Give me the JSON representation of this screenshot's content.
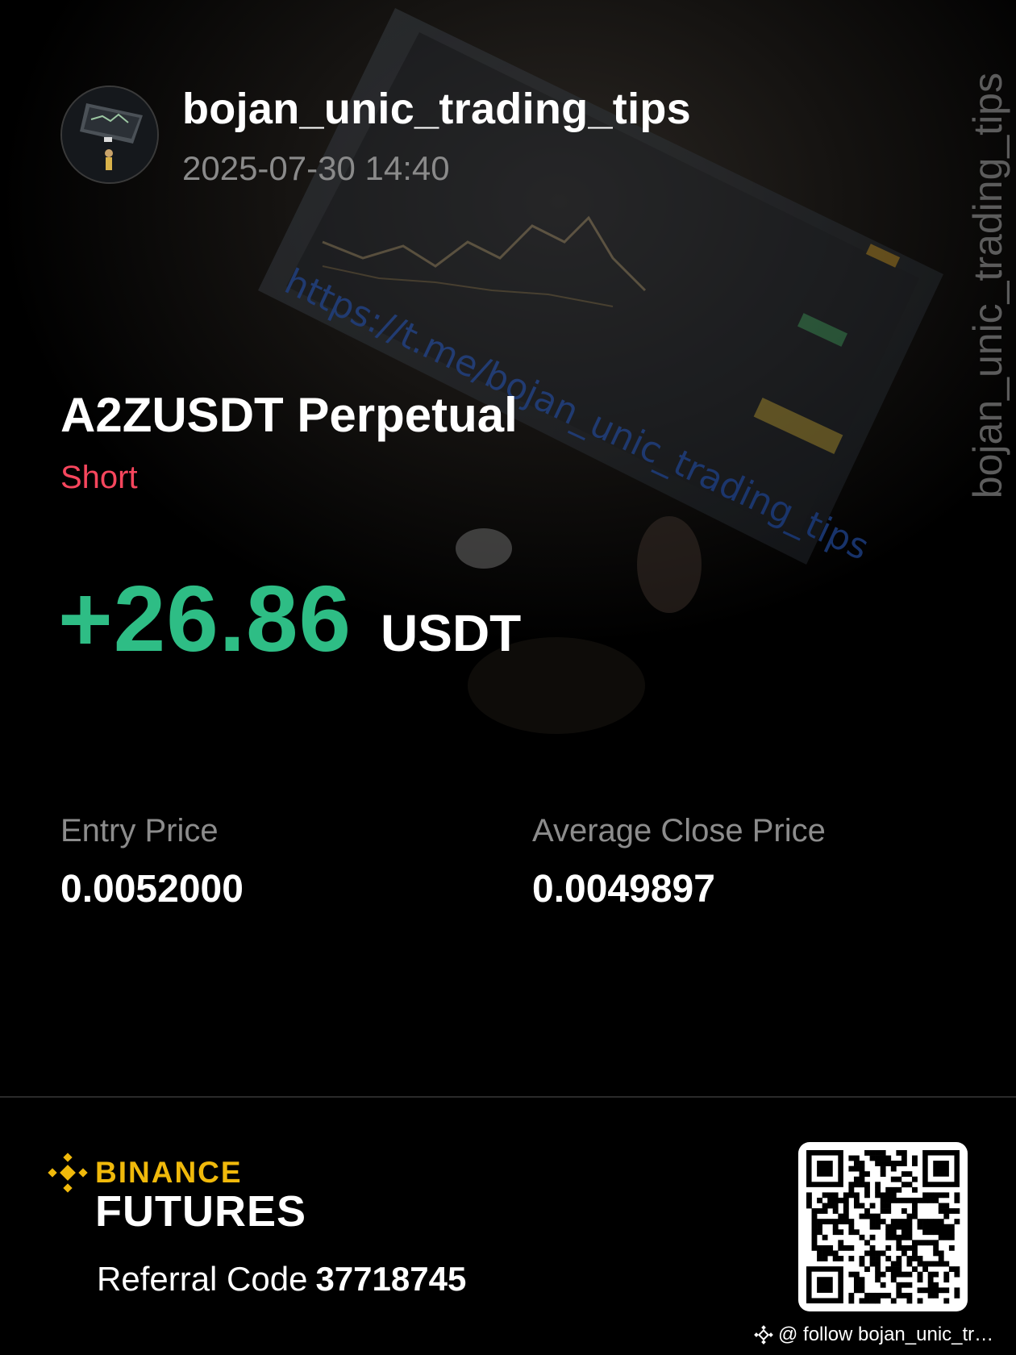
{
  "profile": {
    "username": "bojan_unic_trading_tips",
    "datetime": "2025-07-30 14:40",
    "watermark": "bojan_unic_trading_tips"
  },
  "position": {
    "symbol": "A2ZUSDT Perpetual",
    "side": "Short",
    "pnl_value": "+26.86",
    "pnl_unit": "USDT"
  },
  "prices": {
    "entry_label": "Entry Price",
    "entry_value": "0.0052000",
    "close_label": "Average Close Price",
    "close_value": "0.0049897"
  },
  "footer": {
    "brand_top": "BINANCE",
    "brand_bottom": "FUTURES",
    "referral_label": "Referral Code",
    "referral_code": "37718745",
    "follow_text": "@ follow bojan_unic_tr…"
  },
  "colors": {
    "background": "#000000",
    "profit_green": "#2ebd85",
    "short_red": "#f6465d",
    "binance_yellow": "#f0b90b",
    "muted_gray": "#8c8c8c"
  },
  "icons": {
    "logo": "binance-logo-icon",
    "follow": "binance-small-icon",
    "qr": "qr-code"
  }
}
